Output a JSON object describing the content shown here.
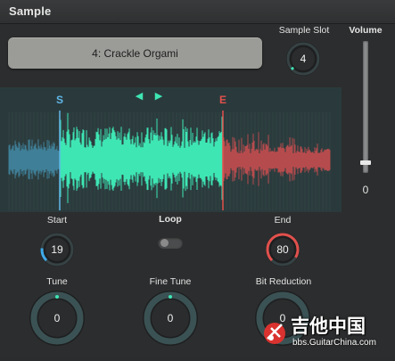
{
  "header": {
    "title": "Sample"
  },
  "sample": {
    "name": "4: Crackle Orgami"
  },
  "sample_slot": {
    "label": "Sample Slot",
    "value": "4"
  },
  "volume": {
    "label": "Volume",
    "value": "0",
    "level": 0.08
  },
  "waveform": {
    "start_marker": "S",
    "end_marker": "E",
    "colors": {
      "pre": "#3f7f97",
      "active": "#3ee6b4",
      "post": "#b64b4d"
    },
    "nav_prev": "◀",
    "nav_next": "▶"
  },
  "start": {
    "label": "Start",
    "value": "19",
    "accent": "#3fa9e8"
  },
  "loop": {
    "label": "Loop",
    "on": false
  },
  "end": {
    "label": "End",
    "value": "80",
    "accent": "#e2504c"
  },
  "tune": {
    "label": "Tune",
    "value": "0"
  },
  "fine_tune": {
    "label": "Fine Tune",
    "value": "0"
  },
  "bit_reduction": {
    "label": "Bit Reduction",
    "value": "0"
  },
  "watermark": {
    "cn": "吉他中国",
    "url": "bbs.GuitarChina.com"
  },
  "accent_teal": "#3ee6b4"
}
